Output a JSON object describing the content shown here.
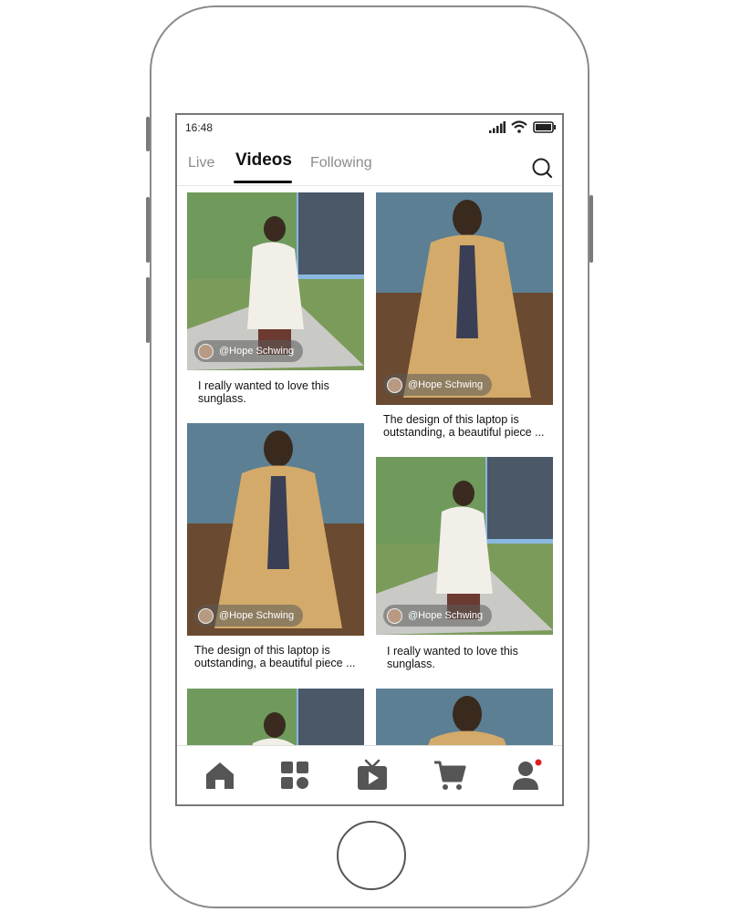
{
  "status_bar": {
    "time": "16:48"
  },
  "tabs": [
    {
      "label": "Live"
    },
    {
      "label": "Videos"
    },
    {
      "label": "Following"
    }
  ],
  "active_tab": "Videos",
  "feed": {
    "left_column": [
      {
        "author": "@Hope Schwing",
        "caption": "I really wanted to love this sunglass.",
        "thumb": "woman-white-coat"
      },
      {
        "author": "@Hope Schwing",
        "caption": "The design of this laptop is outstanding, a beautiful piece ...",
        "thumb": "man-trench-coat"
      },
      {
        "author": "",
        "caption": "",
        "thumb": "woman-white-coat"
      }
    ],
    "right_column": [
      {
        "author": "@Hope Schwing",
        "caption": "The design of this laptop is outstanding, a beautiful piece ...",
        "thumb": "man-trench-coat"
      },
      {
        "author": "@Hope Schwing",
        "caption": "I really wanted to love this sunglass.",
        "thumb": "woman-white-coat"
      },
      {
        "author": "",
        "caption": "",
        "thumb": "man-trench-coat"
      }
    ]
  },
  "bottom_nav": [
    {
      "icon": "home-icon"
    },
    {
      "icon": "grid-icon"
    },
    {
      "icon": "tv-play-icon"
    },
    {
      "icon": "cart-icon"
    },
    {
      "icon": "profile-icon",
      "badge_color": "#e02020"
    }
  ],
  "colors": {
    "icon_gray": "#555555",
    "active_text": "#111111",
    "inactive_text": "#8c8c8c",
    "badge_red": "#e02020"
  }
}
